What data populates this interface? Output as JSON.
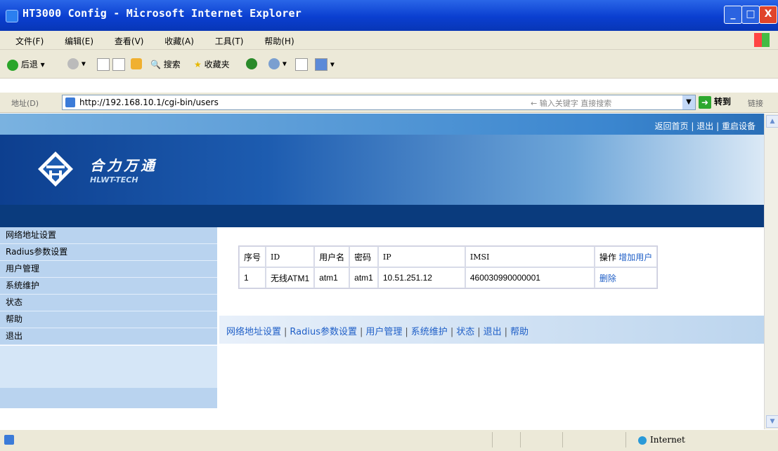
{
  "window": {
    "title": "HT3000 Config - Microsoft Internet Explorer",
    "buttons": {
      "minimize": "_",
      "maximize": "□",
      "close": "X"
    }
  },
  "menubar": {
    "items": [
      "文件(F)",
      "编辑(E)",
      "查看(V)",
      "收藏(A)",
      "工具(T)",
      "帮助(H)"
    ]
  },
  "toolbar": {
    "back": "后退",
    "search": "搜索",
    "favorites": "收藏夹"
  },
  "addressbar": {
    "label": "地址(D)",
    "url": "http://192.168.10.1/cgi-bin/users",
    "search_hint": "← 输入关键字 直接搜索",
    "go": "转到",
    "links": "链接"
  },
  "page": {
    "top_links": [
      "返回首页",
      "退出",
      "重启设备"
    ],
    "logo_cn": "合力万通",
    "logo_en": "HLWT-TECH",
    "nav": [
      "网络地址设置",
      "Radius参数设置",
      "用户管理",
      "系统维护",
      "状态",
      "帮助",
      "退出"
    ],
    "table": {
      "headers": [
        "序号",
        "ID",
        "用户名",
        "密码",
        "IP",
        "IMSI",
        "操作"
      ],
      "add_user": "增加用户",
      "rows": [
        {
          "no": "1",
          "id": "无线ATM1",
          "username": "atm1",
          "password": "atm1",
          "ip": "10.51.251.12",
          "imsi": "460030990000001",
          "action": "删除"
        }
      ]
    },
    "footer_links": [
      "网络地址设置",
      "Radius参数设置",
      "用户管理",
      "系统维护",
      "状态",
      "退出",
      "帮助"
    ]
  },
  "statusbar": {
    "zone": "Internet"
  },
  "colors": {
    "titlebar": "#0a3fd0",
    "nav_bg": "#b9d3ef",
    "link": "#1f5fc7",
    "banner_dark": "#0a3b7d"
  }
}
